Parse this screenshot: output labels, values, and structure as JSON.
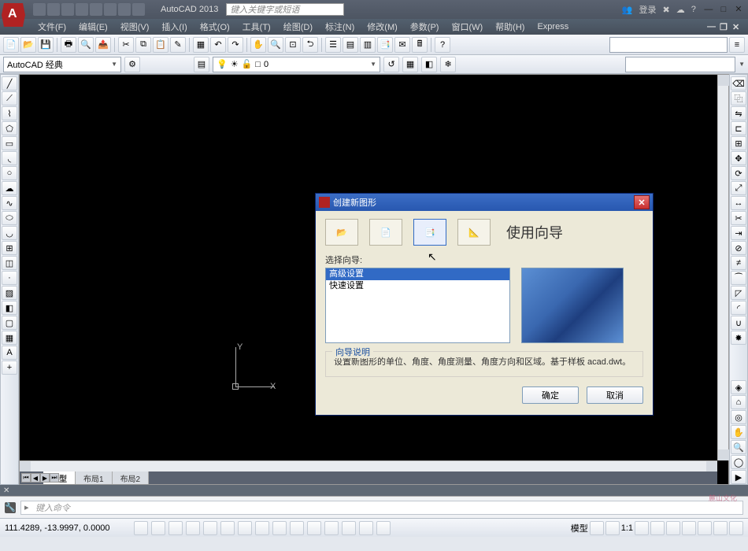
{
  "app": {
    "title": "AutoCAD 2013",
    "search_placeholder": "键入关键字或短语",
    "login": "登录"
  },
  "menus": [
    "文件(F)",
    "编辑(E)",
    "视图(V)",
    "插入(I)",
    "格式(O)",
    "工具(T)",
    "绘图(D)",
    "标注(N)",
    "修改(M)",
    "参数(P)",
    "窗口(W)",
    "帮助(H)",
    "Express"
  ],
  "workspace": "AutoCAD 经典",
  "layer": {
    "name": "0"
  },
  "tabs": {
    "active": "模型",
    "others": [
      "布局1",
      "布局2"
    ]
  },
  "command": {
    "placeholder": "键入命令"
  },
  "status": {
    "coords": "111.4289, -13.9997, 0.0000",
    "label_model": "模型",
    "scale": "1:1"
  },
  "dialog": {
    "title": "创建新图形",
    "mode_title": "使用向导",
    "select_label": "选择向导:",
    "list": [
      "高级设置",
      "快速设置"
    ],
    "selected_index": 0,
    "desc_legend": "向导说明",
    "desc_text": "设置新图形的单位、角度、角度测量、角度方向和区域。基于样板 acad.dwt。",
    "ok": "确定",
    "cancel": "取消"
  },
  "watermark": "麓山文化",
  "ucs": {
    "x": "X",
    "y": "Y"
  }
}
